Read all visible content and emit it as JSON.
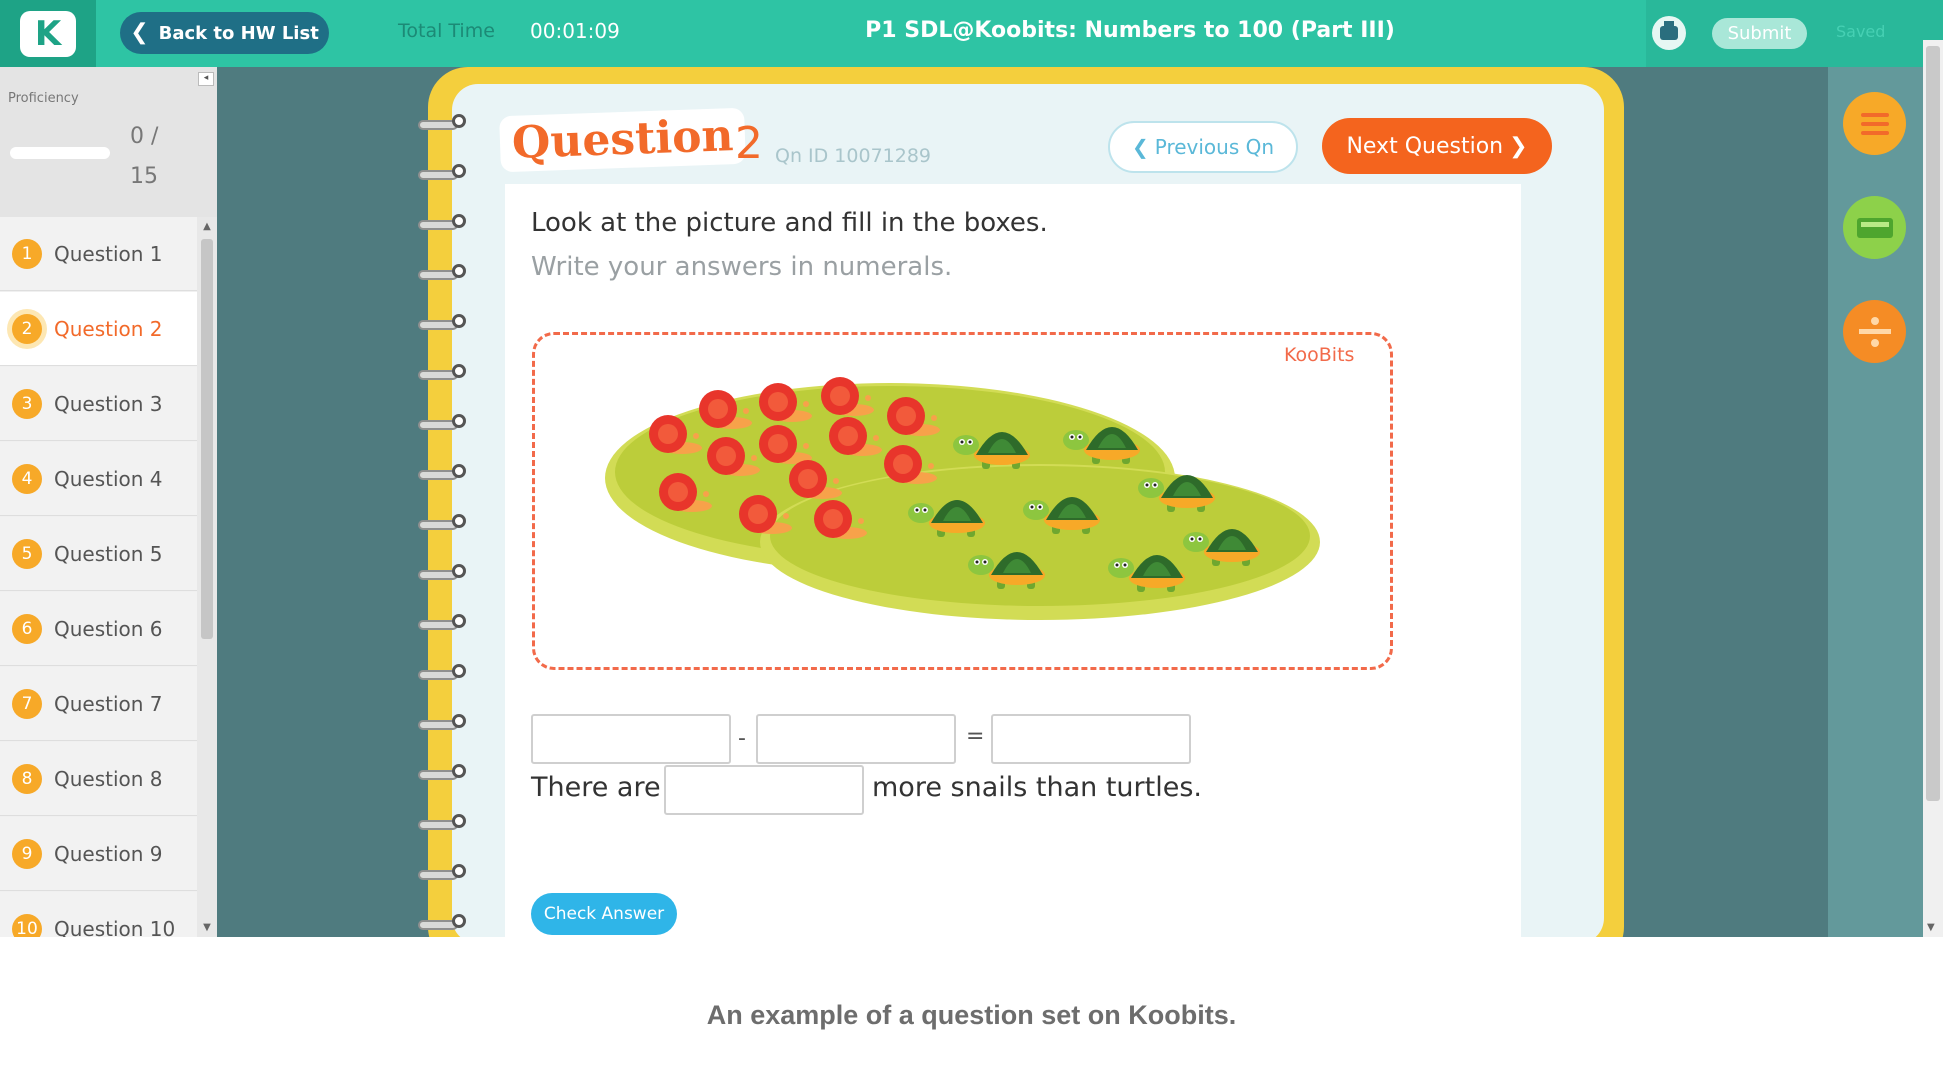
{
  "topbar": {
    "back_label": "Back to HW List",
    "total_time_label": "Total Time",
    "total_time_value": "00:01:09",
    "title": "P1 SDL@Koobits: Numbers to 100 (Part III)",
    "submit_label": "Submit",
    "saved_label": "Saved"
  },
  "sidebar": {
    "proficiency_label": "Proficiency",
    "proficiency_count": "0 / 15",
    "questions": [
      {
        "number": "1",
        "label": "Question 1"
      },
      {
        "number": "2",
        "label": "Question 2"
      },
      {
        "number": "3",
        "label": "Question 3"
      },
      {
        "number": "4",
        "label": "Question 4"
      },
      {
        "number": "5",
        "label": "Question 5"
      },
      {
        "number": "6",
        "label": "Question 6"
      },
      {
        "number": "7",
        "label": "Question 7"
      },
      {
        "number": "8",
        "label": "Question 8"
      },
      {
        "number": "9",
        "label": "Question 9"
      },
      {
        "number": "10",
        "label": "Question 10"
      }
    ],
    "active_question": 2
  },
  "question": {
    "title": "Question",
    "number": "2",
    "qn_id": "Qn ID 10071289",
    "prev_label": "Previous Qn",
    "next_label": "Next Question",
    "instruction": "Look at the picture and fill in the boxes.",
    "subinstruction": "Write your answers in numerals.",
    "picture_brand": "KooBits",
    "minus_sign": "-",
    "equals_sign": "=",
    "sentence_pre": "There are",
    "sentence_post": "more snails than turtles.",
    "check_label": "Check Answer"
  },
  "colors": {
    "topbar": "#2ec4a4",
    "accent_orange": "#f4641e",
    "notebook_yellow": "#f4cf3d",
    "check_blue": "#2fb5e8"
  },
  "icons": [
    "back-chevron-icon",
    "print-icon",
    "previous-chevron-icon",
    "next-chevron-icon",
    "list-tool-icon",
    "calculator-tool-icon",
    "number-bond-tool-icon"
  ],
  "caption": "An example of a question set on Koobits."
}
